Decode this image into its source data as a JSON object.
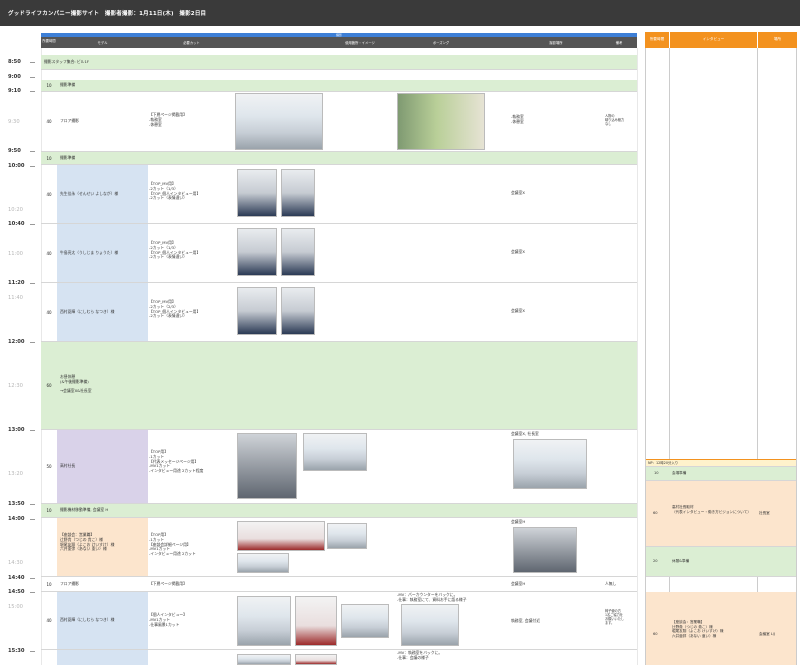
{
  "app": {
    "title": "グッドライフカンパニー撮影サイト　撮影者撮影：1月11日(木)　撮影2日目"
  },
  "schedule_header": {
    "group_label": "撮影",
    "columns": [
      "所要時間",
      "モデル",
      "必要カット",
      "使用箇所・イメージ",
      "ポーズング",
      "撮影場所",
      "備考"
    ]
  },
  "right_header": {
    "columns": [
      "所要時間",
      "インタビュー",
      "場所"
    ]
  },
  "timeline": [
    {
      "label": "8:50",
      "ghost": false
    },
    {
      "label": "9:00",
      "ghost": false
    },
    {
      "label": "9:10",
      "ghost": false
    },
    {
      "label": "9:30",
      "ghost": true
    },
    {
      "label": "9:50",
      "ghost": false
    },
    {
      "label": "10:00",
      "ghost": false
    },
    {
      "label": "10:20",
      "ghost": true
    },
    {
      "label": "10:40",
      "ghost": false
    },
    {
      "label": "11:00",
      "ghost": true
    },
    {
      "label": "11:20",
      "ghost": false
    },
    {
      "label": "11:40",
      "ghost": true
    },
    {
      "label": "12:00",
      "ghost": false
    },
    {
      "label": "12:30",
      "ghost": true
    },
    {
      "label": "13:00",
      "ghost": false
    },
    {
      "label": "13:20",
      "ghost": true
    },
    {
      "label": "13:50",
      "ghost": false
    },
    {
      "label": "14:00",
      "ghost": false
    },
    {
      "label": "14:30",
      "ghost": true
    },
    {
      "label": "14:40",
      "ghost": false
    },
    {
      "label": "14:50",
      "ghost": false
    },
    {
      "label": "15:00",
      "ghost": true
    },
    {
      "label": "15:30",
      "ghost": false
    }
  ],
  "rows": [
    {
      "duration": "",
      "model": "撮影スタッフ集合: ビル1F",
      "cuts": "",
      "location": "",
      "notes": ""
    },
    {
      "duration": "10",
      "model": "撮影準備",
      "cuts": "",
      "location": "",
      "notes": ""
    },
    {
      "duration": "40",
      "model": "フロア撮影",
      "cuts": "【下層ページ掲載用】\n-執務室\n-休憩室",
      "location": "-執務室\n-休憩室",
      "notes": "人物の\n映り込み極力\nなし"
    },
    {
      "duration": "10",
      "model": "撮影準備",
      "cuts": "",
      "location": "",
      "notes": ""
    },
    {
      "duration": "40",
      "model": "先生佳永（せんせい よしなが）様",
      "cuts": "【TOP_MV用】\n-2カット（1/3）\n【TOP_個人インタビュー用】\n-2カット（表情違い）",
      "location": "会議室X",
      "notes": ""
    },
    {
      "duration": "40",
      "model": "牛島亮太（うしじま りょうた）様",
      "cuts": "【TOP_MV用】\n-2カット（1/3）\n【TOP_個人インタビュー用】\n-2カット（表情違い）",
      "location": "会議室X",
      "notes": ""
    },
    {
      "duration": "40",
      "model": "西村夏輝（にしむら なつき）様",
      "cuts": "【TOP_MV用】\n-2カット（2/3）\n【TOP_個人インタビュー用】\n-2カット（表情違い）",
      "location": "会議室X",
      "notes": ""
    },
    {
      "duration": "60",
      "model": "お昼休憩\n(&午後撮影準備)\n\n→会議室X&社長室",
      "cuts": "",
      "location": "",
      "notes": ""
    },
    {
      "duration": "50",
      "model": "高村社長",
      "cuts": "【TOP用】\n-1カット\n【代表メッセージページ用】\n-MV1カット\n-インタビュー用途 2カット程度",
      "location": "会議室X, 社長室",
      "notes": ""
    },
    {
      "duration": "10",
      "model": "撮影機材移動準備, 会議室 H",
      "cuts": "",
      "location": "",
      "notes": ""
    },
    {
      "duration": "",
      "model": "【座談会：営業職】\n辻野貴（つじの 貴こ）様\n堀尾友翔（よこお けいすけ）様\n六井亜弥（あない 亜い）様",
      "cuts": "【TOP用】\n-1カット\n【座談会詳細ページ用】\n-MV1カット\n-インタビュー用途 2カット",
      "location": "会議室H",
      "notes": ""
    },
    {
      "duration": "10",
      "model": "フロア撮影",
      "cuts": "【下層ページ掲載用】",
      "location": "会議室H",
      "notes": "人無し"
    },
    {
      "duration": "40",
      "model": "西村夏輝（にしむら なつき）様",
      "cuts": "【個人インタビュー】\n-MV1カット\n-仕事風景1カット",
      "location": "執務室, 会議付近",
      "notes": "椅子使の方\n1名ご協力を\nお願いいたし\nます。",
      "pose": "-MV：パーカウンターをバックに。\n-仕事：執務室にて、資料お手に語る様子"
    },
    {
      "duration": "",
      "model": "",
      "cuts": "",
      "location": "",
      "notes": "",
      "pose": "-MV：執務室をバックに。\n-仕事：会議の様子"
    }
  ],
  "right_rows": [
    {
      "duration": "NP：12時20分入り",
      "interview": "",
      "place": ""
    },
    {
      "duration": "10",
      "interview": "会場準備",
      "place": ""
    },
    {
      "duration": "60",
      "interview": "高村社長取材\n（代表インタビュー・働き方ビジョンについて）",
      "place": "社長室"
    },
    {
      "duration": "20",
      "interview": "休憩&準備",
      "place": ""
    },
    {
      "duration": "60",
      "interview": "【座談会：営業職】\n辻野貴（つじの 貴こ）様\n堀尾友翔（よこお けいすけ）様\n六井亜弥（あない 亜い）様",
      "place": "会議室 L/J"
    }
  ],
  "colors": {
    "topbar": "#3a3a3a",
    "header_blue": "#3d7fd6",
    "header_gray": "#555555",
    "header_orange": "#f3921f",
    "row_green": "#dbeed3",
    "model_blue": "#d6e3f2",
    "model_purple": "#d9d2e9",
    "model_peach": "#fce5cd"
  }
}
